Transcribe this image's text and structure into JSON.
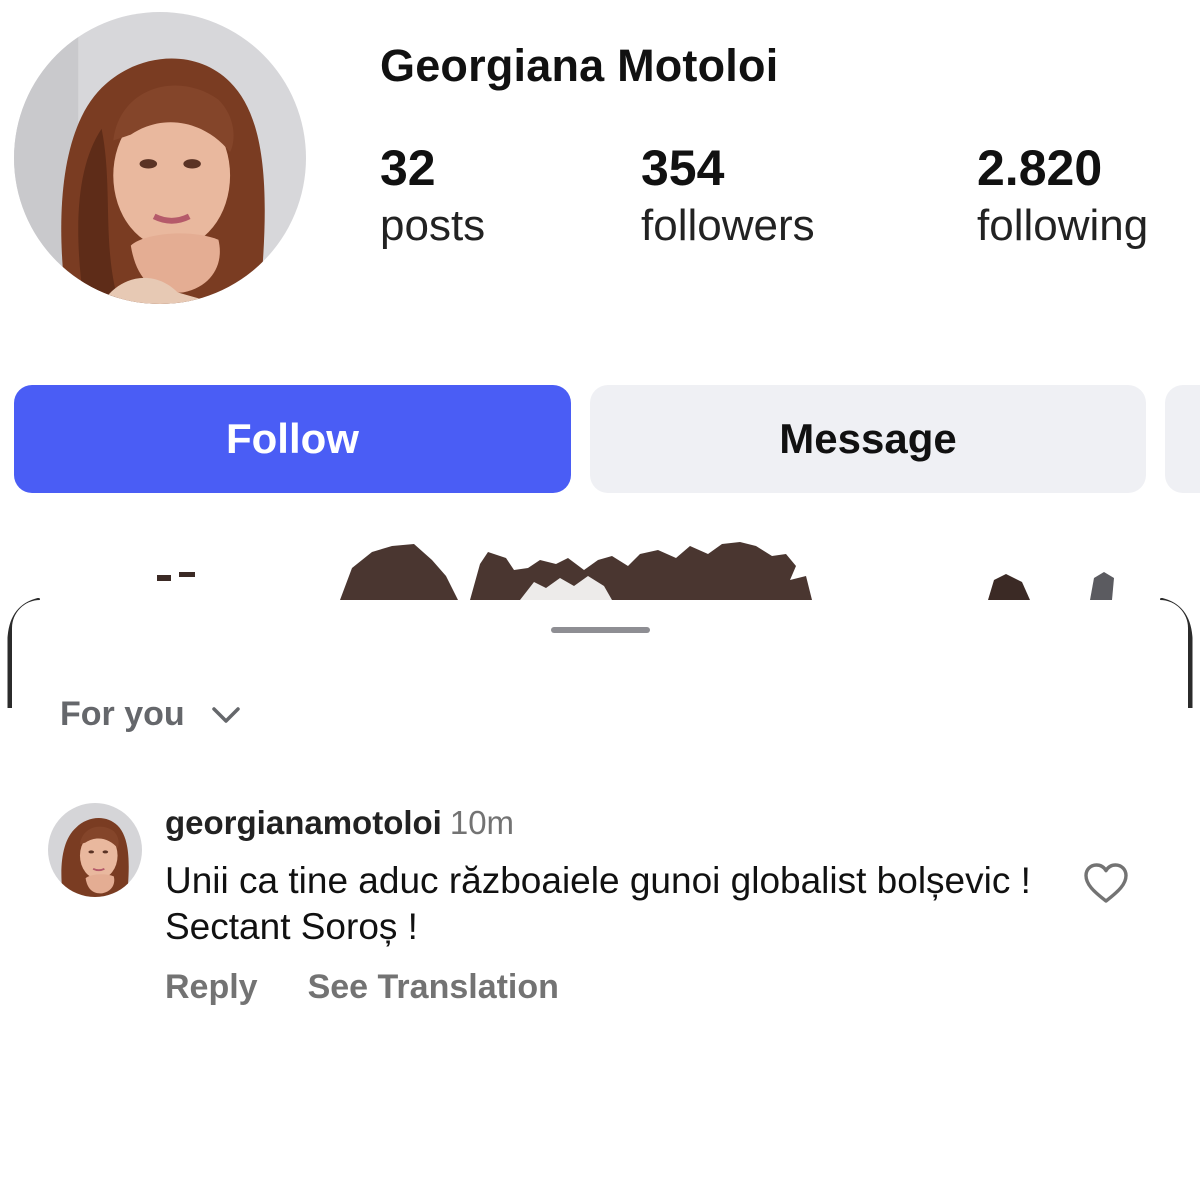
{
  "profile": {
    "name": "Georgiana Motoloi",
    "stats": [
      {
        "value": "32",
        "label": "posts"
      },
      {
        "value": "354",
        "label": "followers"
      },
      {
        "value": "2.820",
        "label": "following"
      }
    ]
  },
  "actions": {
    "follow_label": "Follow",
    "message_label": "Message"
  },
  "comments_sheet": {
    "filter_label": "For you",
    "comment": {
      "username": "georgianamotoloi",
      "time": "10m",
      "text": "Unii ca tine aduc războaiele gunoi globalist bolșevic ! Sectant Soroș !",
      "reply_label": "Reply",
      "translate_label": "See Translation"
    }
  },
  "colors": {
    "follow_button": "#4a5df5",
    "secondary_button": "#eff0f4",
    "muted_text": "#737373"
  },
  "icons": [
    "chevron-down-icon",
    "heart-icon"
  ]
}
